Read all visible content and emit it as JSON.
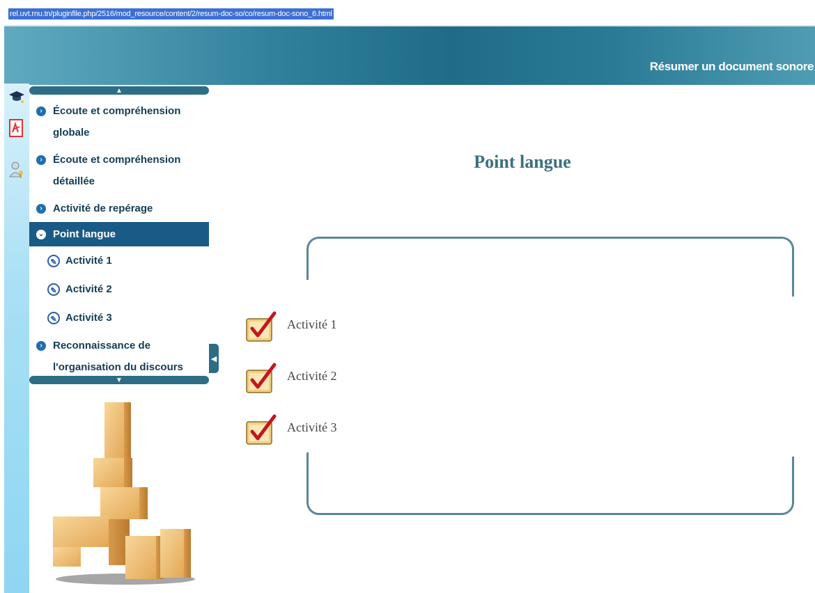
{
  "browser": {
    "url": "rel.uvt.rnu.tn/pluginfile.php/2516/mod_resource/content/2/resum-doc-so/co/resum-doc-sono_6.html"
  },
  "header": {
    "title": "Résumer un document sonore"
  },
  "left_strip": {
    "icons": [
      "graduation-cap-icon",
      "pdf-icon",
      "user-key-icon"
    ]
  },
  "nav": {
    "items": [
      {
        "label": "Écoute et compréhension globale",
        "active": false
      },
      {
        "label": "Écoute et compréhension détaillée",
        "active": false
      },
      {
        "label": "Activité de repérage",
        "active": false
      },
      {
        "label": "Point langue",
        "active": true
      },
      {
        "label": "Reconnaissance de l'organisation du discours",
        "active": false
      }
    ],
    "sub_items": [
      {
        "label": "Activité 1"
      },
      {
        "label": "Activité 2"
      },
      {
        "label": "Activité 3"
      }
    ]
  },
  "main": {
    "title": "Point langue",
    "activities": [
      {
        "label": "Activité 1"
      },
      {
        "label": "Activité 2"
      },
      {
        "label": "Activité 3"
      }
    ]
  },
  "colors": {
    "header": "#2f7e9a",
    "active_nav": "#1a5a86",
    "title": "#3d6f80",
    "frame": "#5b8796"
  }
}
